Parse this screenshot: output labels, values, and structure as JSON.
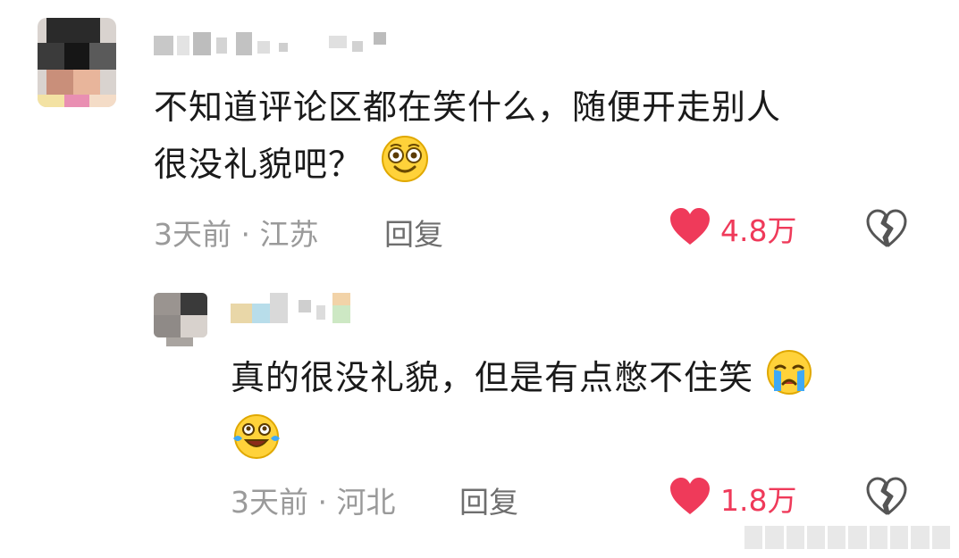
{
  "comments": [
    {
      "text_line1": "不知道评论区都在笑什么，随便开走别人",
      "text_line2": "很没礼貌吧？",
      "emoji": "dizzy-eyes-smile-emoji",
      "time": "3天前",
      "location": "江苏",
      "reply_label": "回复",
      "likes": "4.8万",
      "liked": true
    },
    {
      "text_line1": "真的很没礼貌，但是有点憋不住笑",
      "emoji_inline": "crying-face-emoji",
      "emoji_line2": "laughing-with-tears-emoji",
      "time": "3天前",
      "location": "河北",
      "reply_label": "回复",
      "likes": "1.8万",
      "liked": true
    }
  ],
  "meta_separator": " · ",
  "colors": {
    "like_red": "#ef3a5a",
    "meta_gray": "#9a9a9a",
    "emoji_yellow": "#ffd23a"
  },
  "icons": {
    "like": "heart-icon",
    "dislike": "broken-heart-icon"
  }
}
